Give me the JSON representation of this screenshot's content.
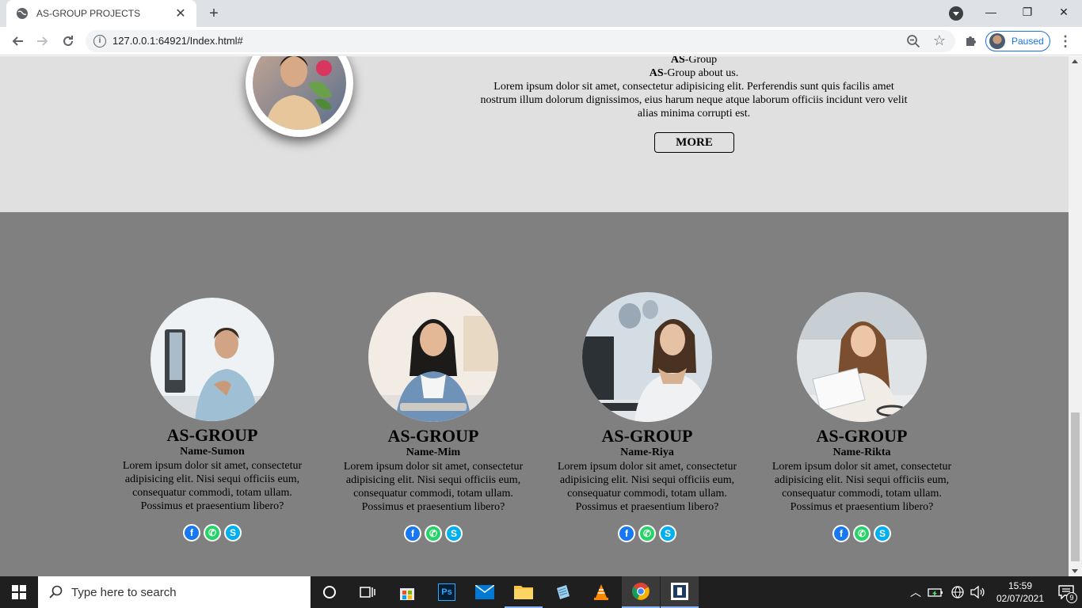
{
  "browser": {
    "tab_title": "AS-GROUP PROJECTS",
    "tab_close": "✕",
    "new_tab": "+",
    "url": "127.0.0.1:64921/Index.html#",
    "profile_label": "Paused",
    "win_minimize": "—",
    "win_restore": "❐",
    "win_close": "✕"
  },
  "about": {
    "brand_bold": "AS",
    "brand_rest": "-Group",
    "about_bold": "AS",
    "about_rest": "-Group about us.",
    "body": "Lorem ipsum dolor sit amet, consectetur adipisicing elit. Perferendis sunt quis facilis amet nostrum illum dolorum dignissimos, eius harum neque atque laborum officiis incidunt vero velit alias minima corrupti est.",
    "more_label": "MORE"
  },
  "team": {
    "members": [
      {
        "brand": "AS-GROUP",
        "name": "Name-Sumon",
        "desc": "Lorem ipsum dolor sit amet, consectetur adipisicing elit. Nisi sequi officiis eum, consequatur commodi, totam ullam. Possimus et praesentium libero?"
      },
      {
        "brand": "AS-GROUP",
        "name": "Name-Mim",
        "desc": "Lorem ipsum dolor sit amet, consectetur adipisicing elit. Nisi sequi officiis eum, consequatur commodi, totam ullam. Possimus et praesentium libero?"
      },
      {
        "brand": "AS-GROUP",
        "name": "Name-Riya",
        "desc": "Lorem ipsum dolor sit amet, consectetur adipisicing elit. Nisi sequi officiis eum, consequatur commodi, totam ullam. Possimus et praesentium libero?"
      },
      {
        "brand": "AS-GROUP",
        "name": "Name-Rikta",
        "desc": "Lorem ipsum dolor sit amet, consectetur adipisicing elit. Nisi sequi officiis eum, consequatur commodi, totam ullam. Possimus et praesentium libero?"
      }
    ],
    "social_icons": [
      "facebook-icon",
      "whatsapp-icon",
      "skype-icon"
    ],
    "social_colors": {
      "facebook": "#1877f2",
      "whatsapp": "#25d366",
      "skype": "#00aff0"
    }
  },
  "taskbar": {
    "search_placeholder": "Type here to search",
    "time": "15:59",
    "date": "02/07/2021",
    "notification_count": "9"
  },
  "colors": {
    "about_bg": "#e0e0e0",
    "team_bg": "#808080",
    "accent": "#1a73e8"
  }
}
